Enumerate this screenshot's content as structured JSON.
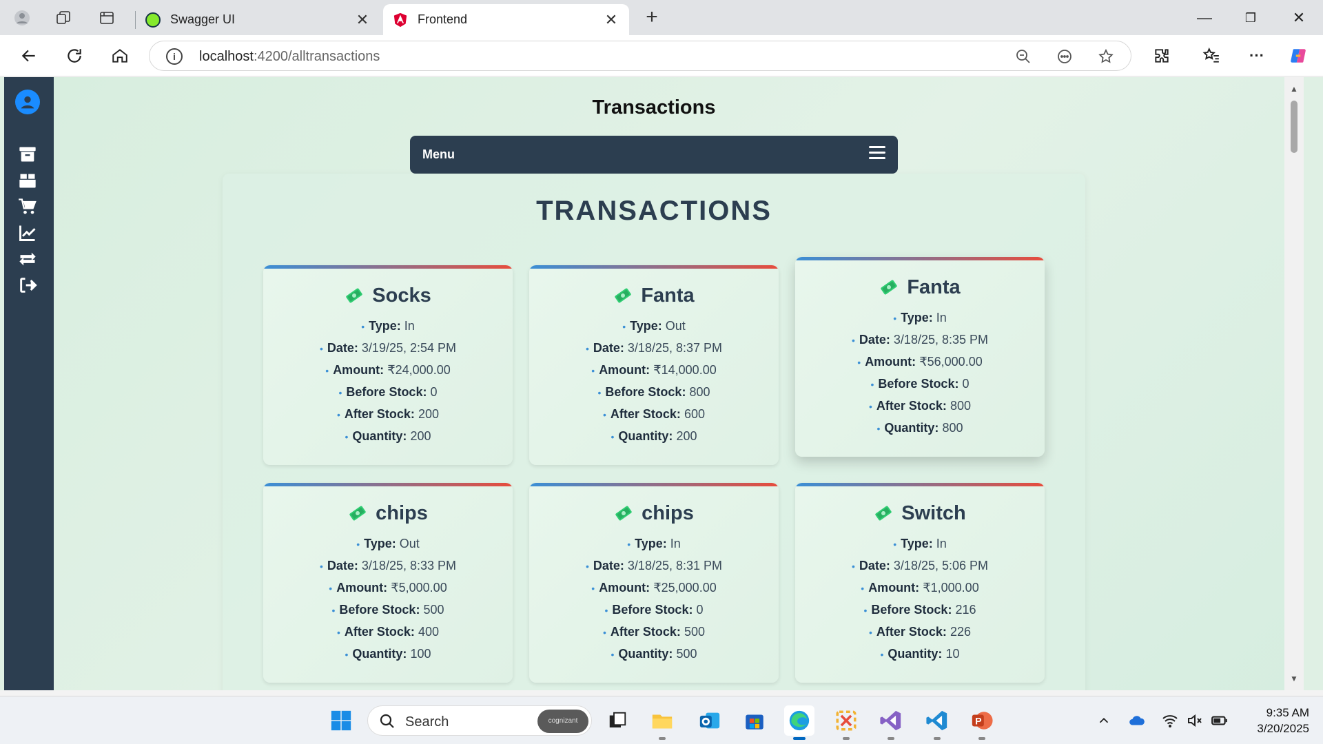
{
  "browser": {
    "tabs": [
      {
        "label": "Swagger UI",
        "active": false
      },
      {
        "label": "Frontend",
        "active": true
      }
    ],
    "url_host": "localhost",
    "url_path": ":4200/alltransactions",
    "colors": {
      "swagger_favicon": "#85ea2d",
      "angular_favicon": "#dd0031"
    }
  },
  "sidebar": {
    "items": [
      {
        "icon": "archive-icon"
      },
      {
        "icon": "box-icon"
      },
      {
        "icon": "cart-icon"
      },
      {
        "icon": "chart-line-icon"
      },
      {
        "icon": "exchange-icon"
      },
      {
        "icon": "logout-icon"
      }
    ],
    "accent": "#2c3e50"
  },
  "page": {
    "title": "Transactions",
    "menu_label": "Menu",
    "section_title": "TRANSACTIONS",
    "field_labels": {
      "type": "Type:",
      "date": "Date:",
      "amount": "Amount:",
      "before": "Before Stock:",
      "after": "After Stock:",
      "qty": "Quantity:"
    },
    "transactions": [
      {
        "name": "Socks",
        "type": "In",
        "date": "3/19/25, 2:54 PM",
        "amount": "₹24,000.00",
        "before": "0",
        "after": "200",
        "qty": "200"
      },
      {
        "name": "Fanta",
        "type": "Out",
        "date": "3/18/25, 8:37 PM",
        "amount": "₹14,000.00",
        "before": "800",
        "after": "600",
        "qty": "200"
      },
      {
        "name": "Fanta",
        "type": "In",
        "date": "3/18/25, 8:35 PM",
        "amount": "₹56,000.00",
        "before": "0",
        "after": "800",
        "qty": "800"
      },
      {
        "name": "chips",
        "type": "Out",
        "date": "3/18/25, 8:33 PM",
        "amount": "₹5,000.00",
        "before": "500",
        "after": "400",
        "qty": "100"
      },
      {
        "name": "chips",
        "type": "In",
        "date": "3/18/25, 8:31 PM",
        "amount": "₹25,000.00",
        "before": "0",
        "after": "500",
        "qty": "500"
      },
      {
        "name": "Switch",
        "type": "In",
        "date": "3/18/25, 5:06 PM",
        "amount": "₹1,000.00",
        "before": "216",
        "after": "226",
        "qty": "10"
      }
    ]
  },
  "taskbar": {
    "search_placeholder": "Search",
    "search_badge": "cognizant",
    "time": "9:35 AM",
    "date": "3/20/2025"
  }
}
